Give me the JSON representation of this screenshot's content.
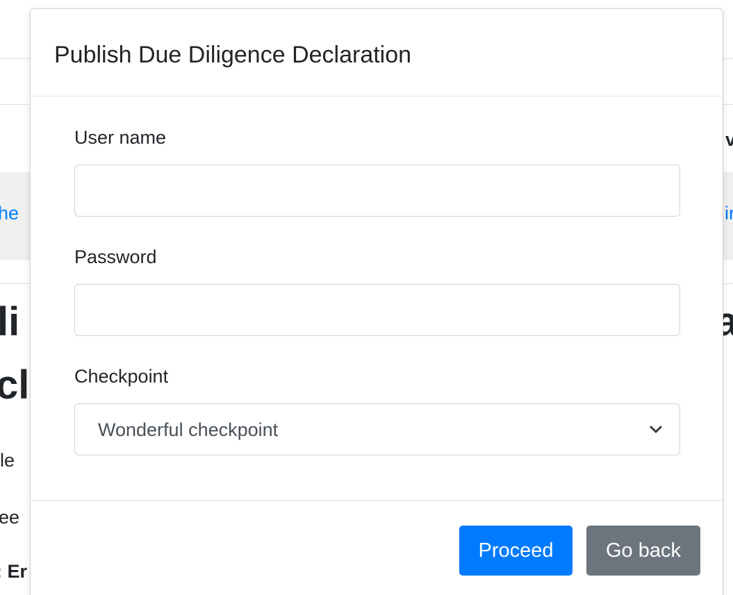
{
  "background": {
    "link_left": "he",
    "link_right": "ir",
    "heading_left_1": "li",
    "heading_left_2": "cl",
    "heading_right_1": "a",
    "text_left_1": "le",
    "text_left_2": "ee",
    "text_left_bold": ": Er",
    "text_right_bold": "v"
  },
  "modal": {
    "title": "Publish Due Diligence Declaration",
    "fields": {
      "username": {
        "label": "User name",
        "value": "",
        "placeholder": ""
      },
      "password": {
        "label": "Password",
        "value": "",
        "placeholder": ""
      },
      "checkpoint": {
        "label": "Checkpoint",
        "selected": "Wonderful checkpoint"
      }
    },
    "buttons": {
      "proceed": "Proceed",
      "go_back": "Go back"
    }
  },
  "colors": {
    "primary": "#007bff",
    "secondary": "#6c757d",
    "border": "#ced4da"
  },
  "icons": {
    "select_indicator": "chevron-down-icon"
  }
}
